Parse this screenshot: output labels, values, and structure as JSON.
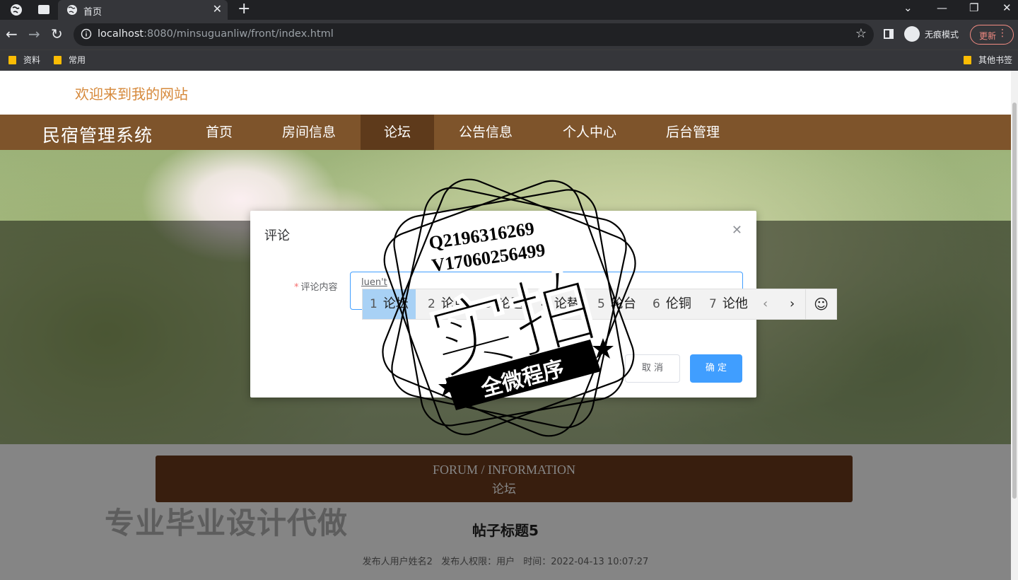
{
  "browser": {
    "tab_title": "首页",
    "url_host": "localhost",
    "url_rest": ":8080/minsuguanliw/front/index.html",
    "incognito_label": "无痕模式",
    "update_label": "更新",
    "bookmarks": [
      "资料",
      "常用"
    ],
    "other_bookmarks": "其他书签"
  },
  "site": {
    "welcome": "欢迎来到我的网站",
    "brand": "民宿管理系统",
    "nav": [
      "首页",
      "房间信息",
      "论坛",
      "公告信息",
      "个人中心",
      "后台管理"
    ],
    "active_nav": "论坛"
  },
  "forum": {
    "title_en": "FORUM / INFORMATION",
    "title_cn": "论坛",
    "post_title": "帖子标题5",
    "meta": {
      "author": "发布人用户姓名2",
      "role": "发布人权限：用户",
      "time": "时间：2022-04-13 10:07:27"
    }
  },
  "dialog": {
    "title": "评论",
    "field_label": "评论内容",
    "field_value": "luen't",
    "cancel": "取 消",
    "confirm": "确 定"
  },
  "ime": {
    "candidates": [
      {
        "num": "1",
        "text": "论坛"
      },
      {
        "num": "2",
        "text": "论点"
      },
      {
        "num": "3",
        "text": "论题"
      },
      {
        "num": "4",
        "text": "论替"
      },
      {
        "num": "5",
        "text": "轮台"
      },
      {
        "num": "6",
        "text": "伦铜"
      },
      {
        "num": "7",
        "text": "论他"
      }
    ],
    "prev": "‹",
    "next": "›",
    "emoji": "☺"
  },
  "watermark": {
    "line1": "Q2196316269",
    "line2": "V17060256499",
    "main": "实拍",
    "ribbon": "全微程序",
    "bottom": "专业毕业设计代做"
  },
  "colors": {
    "navbar": "#7e542b",
    "nav_active": "#5e3a1b",
    "welcome": "#d6893b",
    "primary": "#409eff",
    "forum_box": "#6b3a1b"
  }
}
